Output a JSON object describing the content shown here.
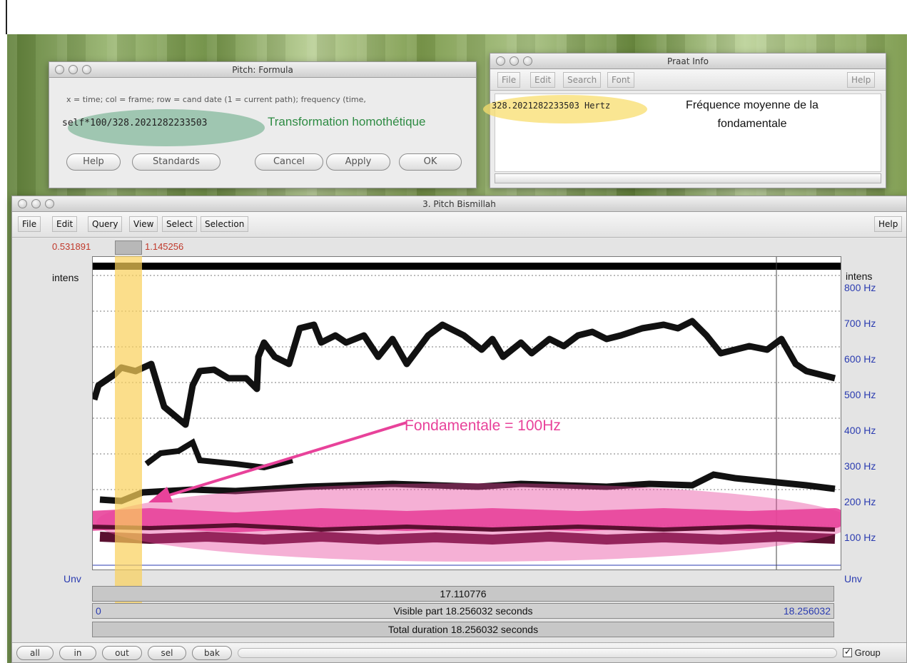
{
  "formula_window": {
    "title": "Pitch: Formula",
    "description": "x = time; col = frame; row = cand date (1 = current path); frequency (time,",
    "expression": "self*100/328.2021282233503",
    "annotation": "Transformation homothétique",
    "buttons": {
      "help": "Help",
      "standards": "Standards",
      "cancel": "Cancel",
      "apply": "Apply",
      "ok": "OK"
    }
  },
  "info_window": {
    "title": "Praat Info",
    "menu": [
      "File",
      "Edit",
      "Search",
      "Font"
    ],
    "help": "Help",
    "value": "328.2021282233503 Hertz",
    "annotation_line1": "Fréquence moyenne de la",
    "annotation_line2": "fondamentale"
  },
  "pitch_window": {
    "title": "3. Pitch Bismillah",
    "menu": [
      "File",
      "Edit",
      "Query",
      "View",
      "Select",
      "Selection"
    ],
    "help": "Help",
    "selection_start": "0.531891",
    "selection_end": "1.145256",
    "intens_left": "intens",
    "intens_right": "intens",
    "y_labels": [
      "800 Hz",
      "700 Hz",
      "600 Hz",
      "500 Hz",
      "400 Hz",
      "300 Hz",
      "200 Hz",
      "100 Hz"
    ],
    "unv_left": "Unv",
    "unv_right": "Unv",
    "cursor_time": "17.110776",
    "visible_start": "0",
    "visible_part": "Visible part 18.256032 seconds",
    "visible_end": "18.256032",
    "total_duration": "Total duration 18.256032 seconds",
    "annotation": "Fondamentale = 100Hz",
    "bottom_buttons": [
      "all",
      "in",
      "out",
      "sel",
      "bak"
    ],
    "group_label": "Group",
    "group_checked": true
  },
  "colors": {
    "annotation_pink": "#e8429a",
    "selection_yellow": "#fad05a",
    "axis_blue": "#2a3bb0",
    "selection_red": "#c0392b",
    "annotation_green": "#2e8b43"
  }
}
